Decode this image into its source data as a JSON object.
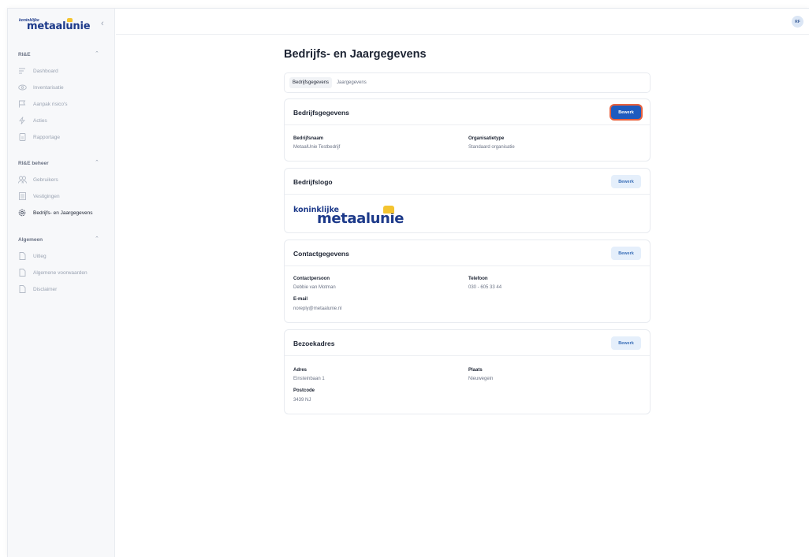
{
  "brand": {
    "small": "koninklijke",
    "big": "metaalunie"
  },
  "user": {
    "initials": "RF"
  },
  "sidebar": {
    "sections": [
      {
        "title": "RI&E",
        "items": [
          {
            "label": "Dashboard",
            "icon": "dashboard-icon"
          },
          {
            "label": "Inventarisatie",
            "icon": "eye-icon"
          },
          {
            "label": "Aanpak risico's",
            "icon": "flag-icon"
          },
          {
            "label": "Acties",
            "icon": "bolt-icon"
          },
          {
            "label": "Rapportage",
            "icon": "document-icon"
          }
        ]
      },
      {
        "title": "RI&E beheer",
        "items": [
          {
            "label": "Gebruikers",
            "icon": "users-icon"
          },
          {
            "label": "Vestigingen",
            "icon": "building-icon"
          },
          {
            "label": "Bedrijfs- en Jaargegevens",
            "icon": "gear-icon",
            "active": true
          }
        ]
      },
      {
        "title": "Algemeen",
        "items": [
          {
            "label": "Uitleg",
            "icon": "file-icon"
          },
          {
            "label": "Algemene voorwaarden",
            "icon": "file-icon"
          },
          {
            "label": "Disclaimer",
            "icon": "file-icon"
          }
        ]
      }
    ]
  },
  "main": {
    "title": "Bedrijfs- en Jaargegevens",
    "tabs": [
      {
        "label": "Bedrijfsgegevens",
        "active": true
      },
      {
        "label": "Jaargegevens",
        "active": false
      }
    ],
    "edit_label": "Bewerk",
    "cards": {
      "company": {
        "title": "Bedrijfsgegevens",
        "fields": [
          {
            "label": "Bedrijfsnaam",
            "value": "MetaalUnie Testbedrijf"
          },
          {
            "label": "Organisatietype",
            "value": "Standaard organisatie"
          }
        ]
      },
      "logo": {
        "title": "Bedrijfslogo"
      },
      "contact": {
        "title": "Contactgegevens",
        "fields": [
          {
            "label": "Contactpersoon",
            "value": "Debbie van Motman"
          },
          {
            "label": "Telefoon",
            "value": "030 - 605 33 44"
          },
          {
            "label": "E-mail",
            "value": "noreply@metaalunie.nl"
          }
        ]
      },
      "address": {
        "title": "Bezoekadres",
        "fields": [
          {
            "label": "Adres",
            "value": "Einsteinbaan 1"
          },
          {
            "label": "Plaats",
            "value": "Nieuwegein"
          },
          {
            "label": "Postcode",
            "value": "3439 NJ"
          }
        ]
      }
    }
  },
  "colors": {
    "primary": "#1e5bbf",
    "highlight": "#e8603c",
    "brand_blue": "#1d3a8a",
    "brand_gold": "#f4c430"
  }
}
